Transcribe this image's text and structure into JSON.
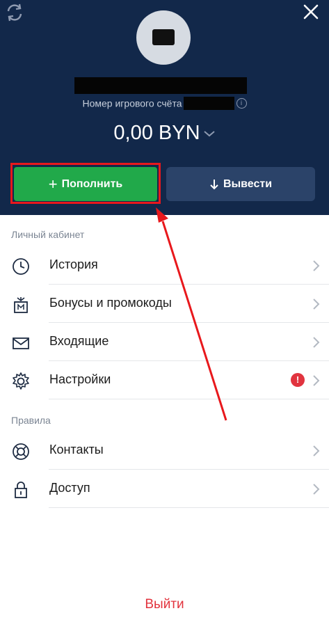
{
  "header": {
    "account_label": "Номер игрового счёта",
    "balance": "0,00 BYN",
    "info_icon": "info-icon",
    "refresh_icon": "refresh-icon",
    "close_icon": "close-icon"
  },
  "actions": {
    "deposit_label": "Пополнить",
    "deposit_icon": "plus-icon",
    "withdraw_label": "Вывести",
    "withdraw_icon": "arrow-down-icon",
    "deposit_color": "#21a94a",
    "withdraw_color": "#2b4369"
  },
  "sections": {
    "personal": "Личный кабинет",
    "rules": "Правила"
  },
  "menu": [
    {
      "label": "История",
      "icon": "clock-icon"
    },
    {
      "label": "Бонусы и промокоды",
      "icon": "gift-icon"
    },
    {
      "label": "Входящие",
      "icon": "envelope-icon"
    },
    {
      "label": "Настройки",
      "icon": "gear-icon",
      "badge": "!"
    },
    {
      "label": "Контакты",
      "icon": "lifebuoy-icon"
    },
    {
      "label": "Доступ",
      "icon": "lock-icon"
    }
  ],
  "logout_label": "Выйти",
  "colors": {
    "header_bg": "#12284a",
    "highlight": "#e8181c",
    "logout": "#e2323c"
  }
}
